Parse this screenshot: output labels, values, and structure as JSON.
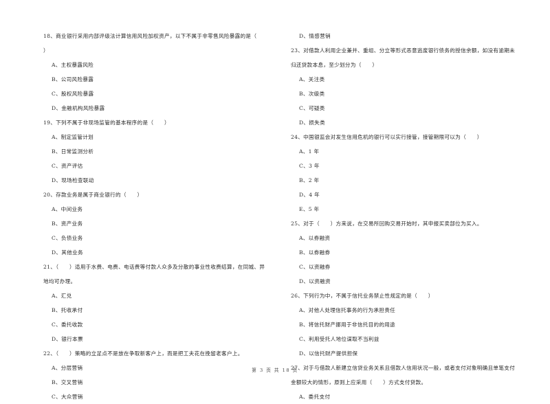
{
  "page": {
    "footer": "第 3 页 共 18 页"
  },
  "left_column": [
    {
      "kind": "q",
      "text": "18、商业银行采用内部评级法计算信用风险加权资产，以下不属于非零售风险暴露的是（"
    },
    {
      "kind": "q",
      "text": "）"
    },
    {
      "kind": "opt",
      "text": "A、主权暴露风险"
    },
    {
      "kind": "opt",
      "text": "B、公司风险暴露"
    },
    {
      "kind": "opt",
      "text": "C、股权风险暴露"
    },
    {
      "kind": "opt",
      "text": "D、金融机构风险暴露"
    },
    {
      "kind": "q",
      "text": "19、下列不属于非现场监管的基本程序的是（　　）"
    },
    {
      "kind": "opt",
      "text": "A、制定监管计划"
    },
    {
      "kind": "opt",
      "text": "B、日常监测分析"
    },
    {
      "kind": "opt",
      "text": "C、资产评估"
    },
    {
      "kind": "opt",
      "text": "D、现场检查联动"
    },
    {
      "kind": "q",
      "text": "20、存款业务是属于商业银行的（　　）"
    },
    {
      "kind": "opt",
      "text": "A、中间业务"
    },
    {
      "kind": "opt",
      "text": "B、资产业务"
    },
    {
      "kind": "opt",
      "text": "C、负债业务"
    },
    {
      "kind": "opt",
      "text": "D、其他业务"
    },
    {
      "kind": "q",
      "text": "21、（　　）适用于水费、电费、电话费等付款人众多及分散的事业性收费结算，在同城、异"
    },
    {
      "kind": "q",
      "text": "地均可办理。"
    },
    {
      "kind": "opt",
      "text": "A、汇兑"
    },
    {
      "kind": "opt",
      "text": "B、托收承付"
    },
    {
      "kind": "opt",
      "text": "C、委托收款"
    },
    {
      "kind": "opt",
      "text": "D、银行本票"
    },
    {
      "kind": "q",
      "text": "22、（　　）策略的立足点不是放在争取新客户上，而是把工夫花在挽留老客户上。"
    },
    {
      "kind": "opt",
      "text": "A、分层营销"
    },
    {
      "kind": "opt",
      "text": "B、交叉营销"
    },
    {
      "kind": "opt",
      "text": "C、大众营销"
    }
  ],
  "right_column": [
    {
      "kind": "opt",
      "text": "D、情感营销"
    },
    {
      "kind": "q",
      "text": "23、对借款人利用企业兼并、重组、分立等形式恶意逃废银行债务的授信余额，如没有逾期未"
    },
    {
      "kind": "q",
      "text": "归还贷款本息，至少划分为（　　）"
    },
    {
      "kind": "opt",
      "text": "A、关注类"
    },
    {
      "kind": "opt",
      "text": "B、次级类"
    },
    {
      "kind": "opt",
      "text": "C、可疑类"
    },
    {
      "kind": "opt",
      "text": "D、损失类"
    },
    {
      "kind": "q",
      "text": "24、中国银监会对发生信用危机的银行可以实行接管，接管期限可以为（　　）"
    },
    {
      "kind": "opt",
      "text": "A、1 年"
    },
    {
      "kind": "opt",
      "text": "C、3 年"
    },
    {
      "kind": "opt",
      "text": "B、2 年"
    },
    {
      "kind": "opt",
      "text": "D、4 年"
    },
    {
      "kind": "opt",
      "text": "E、5 年"
    },
    {
      "kind": "q",
      "text": "25、对于（　　）方来说，在交易所回购交易开始时，其申报买卖部位为买入。"
    },
    {
      "kind": "opt",
      "text": "A、以券融资"
    },
    {
      "kind": "opt",
      "text": "B、以券融券"
    },
    {
      "kind": "opt",
      "text": "C、以资融券"
    },
    {
      "kind": "opt",
      "text": "D、以资融资"
    },
    {
      "kind": "q",
      "text": "26、下列行为中，不属于信托业务禁止性规定的是（　　）"
    },
    {
      "kind": "opt",
      "text": "A、对他人处理信托事务的行为承担责任"
    },
    {
      "kind": "opt",
      "text": "B、将信托财产挪用于非信托目的的用途"
    },
    {
      "kind": "opt",
      "text": "C、利用受托人地位谋取不当利益"
    },
    {
      "kind": "opt",
      "text": "D、以信托财产提供担保"
    },
    {
      "kind": "q",
      "text": "27、对于与借款人新建立信贷业务关系且借款人信用状况一般，或者支付对象明确且单笔支付"
    },
    {
      "kind": "q",
      "text": "金额较大的情形，原则上应采用（　　）方式支付贷款。"
    },
    {
      "kind": "opt",
      "text": "A、委托支付"
    }
  ]
}
